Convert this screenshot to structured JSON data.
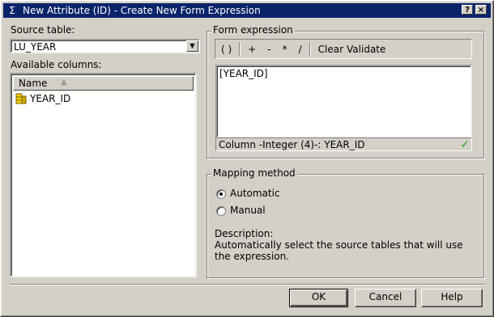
{
  "window": {
    "title": "New Attribute (ID) - Create New Form Expression",
    "title_icon": "sigma-icon",
    "help_glyph": "?",
    "close_glyph": "×"
  },
  "source_table": {
    "label": "Source table:",
    "value": "LU_YEAR"
  },
  "available_columns": {
    "label": "Available columns:",
    "header": "Name",
    "items": [
      {
        "label": "YEAR_ID",
        "icon": "column-key-icon"
      }
    ]
  },
  "form_expression": {
    "title": "Form expression",
    "toolbar": [
      "( )",
      "+",
      "-",
      "*",
      "/",
      "Clear",
      "Validate"
    ],
    "expression": "[YEAR_ID]",
    "status": "Column -Integer (4)-: YEAR_ID",
    "status_icon": "checkmark-icon"
  },
  "mapping_method": {
    "title": "Mapping method",
    "options": [
      {
        "label": "Automatic",
        "selected": true
      },
      {
        "label": "Manual",
        "selected": false
      }
    ],
    "description_label": "Description:",
    "description": "Automatically select the source tables that will use the expression."
  },
  "buttons": {
    "ok": "OK",
    "cancel": "Cancel",
    "help": "Help"
  }
}
